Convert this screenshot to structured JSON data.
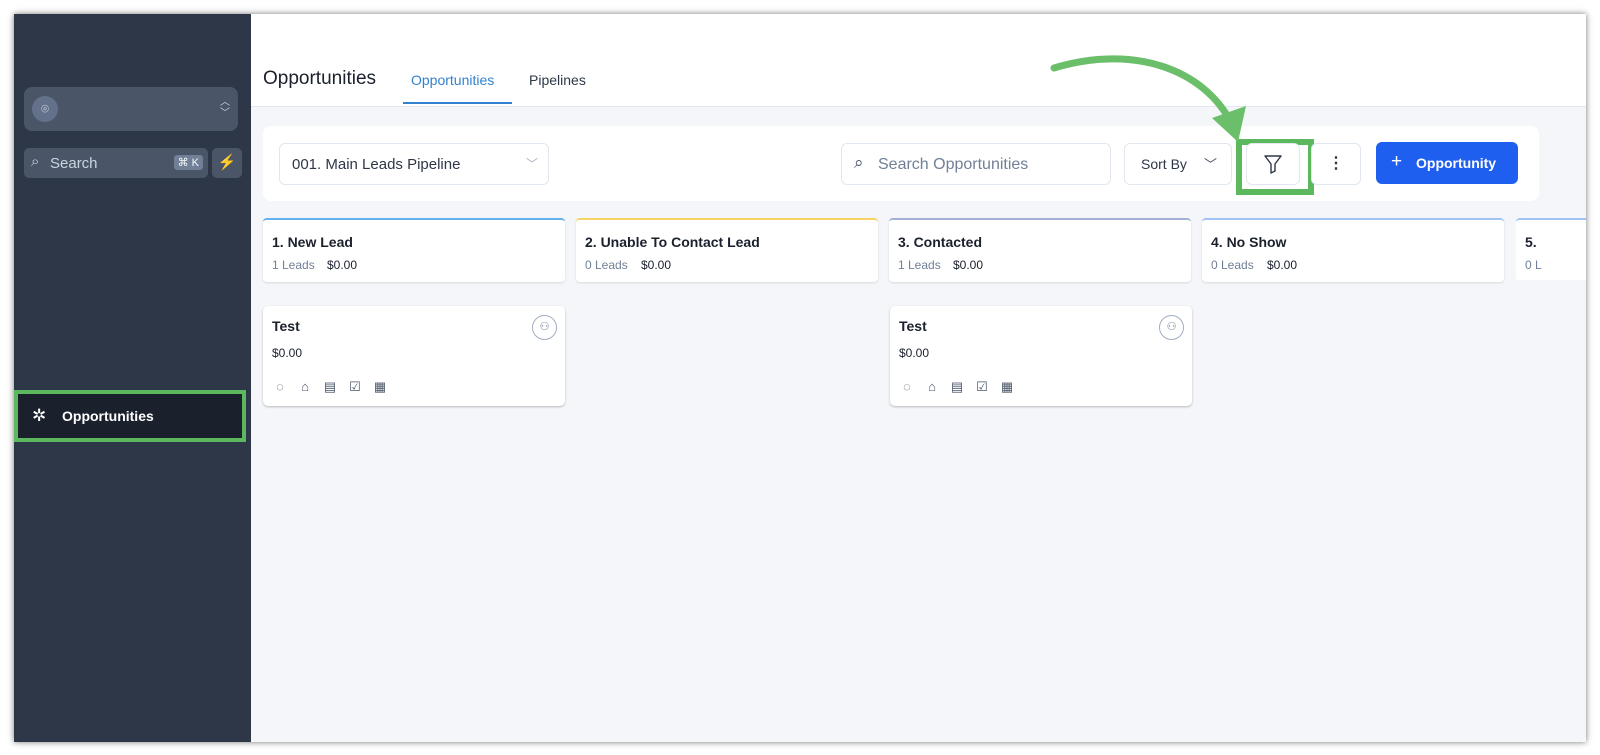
{
  "sidebar": {
    "location_avatar_icon": "user-pin-icon",
    "search_placeholder": "Search",
    "search_shortcut": "⌘ K",
    "nav": {
      "opportunities_label": "Opportunities"
    }
  },
  "header": {
    "title": "Opportunities",
    "tabs": [
      {
        "label": "Opportunities",
        "active": true
      },
      {
        "label": "Pipelines",
        "active": false
      }
    ]
  },
  "toolbar": {
    "pipeline_value": "001. Main Leads Pipeline",
    "search_placeholder": "Search Opportunities",
    "sort_label": "Sort By",
    "add_label": "Opportunity"
  },
  "stages": [
    {
      "name": "1. New Lead",
      "count": "1 Leads",
      "amount": "$0.00",
      "color": "#63b3ed"
    },
    {
      "name": "2. Unable To Contact Lead",
      "count": "0 Leads",
      "amount": "$0.00",
      "color": "#f6d365"
    },
    {
      "name": "3. Contacted",
      "count": "1 Leads",
      "amount": "$0.00",
      "color": "#a3b1d6"
    },
    {
      "name": "4. No Show",
      "count": "0 Leads",
      "amount": "$0.00",
      "color": "#a3c4f3"
    },
    {
      "name": "5.",
      "count": "0 L",
      "amount": "",
      "color": "#a3c4f3"
    }
  ],
  "cards": [
    {
      "title": "Test",
      "value": "$0.00"
    },
    {
      "title": "Test",
      "value": "$0.00"
    }
  ],
  "colors": {
    "accent": "#1f5ff0",
    "highlight": "#5cb85c",
    "sidebar": "#2d3748"
  }
}
